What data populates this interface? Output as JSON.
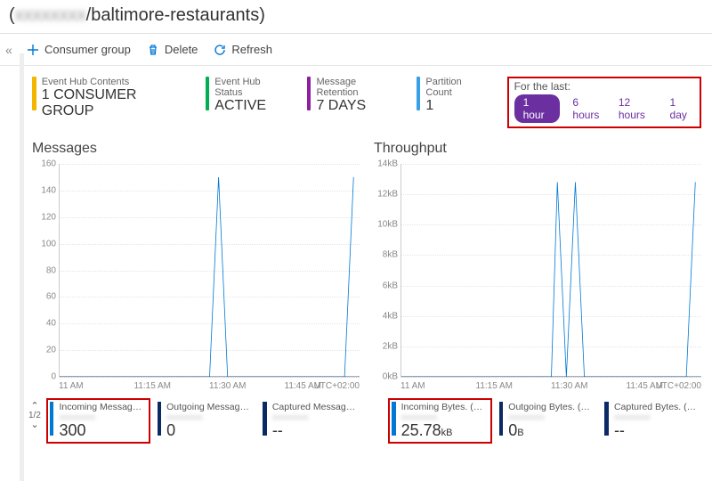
{
  "title_prefix_blurred": "xxxxxxxx",
  "title_suffix": "/baltimore-restaurants)",
  "toolbar": {
    "consumer_group": "Consumer group",
    "delete": "Delete",
    "refresh": "Refresh"
  },
  "stats": {
    "contents": {
      "label": "Event Hub Contents",
      "value": "1 CONSUMER GROUP",
      "color": "#f2b600"
    },
    "status": {
      "label": "Event Hub Status",
      "value": "ACTIVE",
      "color": "#00b050"
    },
    "retention": {
      "label": "Message Retention",
      "value": "7 DAYS",
      "color": "#8e1fa0"
    },
    "partition": {
      "label": "Partition Count",
      "value": "1",
      "color": "#39a0e8"
    }
  },
  "time_picker": {
    "header": "For the last:",
    "active": "1 hour",
    "options": [
      "1 hour",
      "6 hours",
      "12 hours",
      "1 day"
    ]
  },
  "charts": {
    "messages": {
      "title": "Messages",
      "timezone": "UTC+02:00"
    },
    "throughput": {
      "title": "Throughput",
      "timezone": "UTC+02:00"
    }
  },
  "legend": {
    "pager": "1/2",
    "messages": {
      "incoming": {
        "name": "Incoming Messages (Sum)",
        "value": "300",
        "unit": "",
        "color": "#0078d4"
      },
      "outgoing": {
        "name": "Outgoing Messages (Sum)",
        "value": "0",
        "unit": "",
        "color": "#0a2a66"
      },
      "captured": {
        "name": "Captured Messages. (…",
        "value": "--",
        "unit": "",
        "color": "#0a2a66"
      }
    },
    "throughput": {
      "incoming": {
        "name": "Incoming Bytes. (Sum)",
        "value": "25.78",
        "unit": "kB",
        "color": "#0078d4"
      },
      "outgoing": {
        "name": "Outgoing Bytes. (Sum)",
        "value": "0",
        "unit": "B",
        "color": "#0a2a66"
      },
      "captured": {
        "name": "Captured Bytes. (Sum)",
        "value": "--",
        "unit": "",
        "color": "#0a2a66"
      }
    }
  },
  "chart_data": [
    {
      "type": "line",
      "title": "Messages",
      "xlabel": "",
      "ylabel": "",
      "ylim": [
        0,
        160
      ],
      "yticks": [
        0,
        20,
        40,
        60,
        80,
        100,
        120,
        140,
        160
      ],
      "x_categories": [
        "11 AM",
        "11:15 AM",
        "11:30 AM",
        "11:45 AM"
      ],
      "series": [
        {
          "name": "Incoming Messages (Sum)",
          "color": "#0078d4",
          "points": [
            [
              0,
              0
            ],
            [
              0.5,
              0
            ],
            [
              0.53,
              150
            ],
            [
              0.56,
              0
            ],
            [
              0.95,
              0
            ],
            [
              0.98,
              150
            ]
          ]
        },
        {
          "name": "Outgoing Messages (Sum)",
          "color": "#0a2a66",
          "points": [
            [
              0,
              0
            ],
            [
              1,
              0
            ]
          ]
        },
        {
          "name": "Captured Messages",
          "color": "#0a2a66",
          "points": []
        }
      ]
    },
    {
      "type": "line",
      "title": "Throughput",
      "xlabel": "",
      "ylabel": "",
      "ylim": [
        0,
        14
      ],
      "yunit": "kB",
      "yticks": [
        0,
        2,
        4,
        6,
        8,
        10,
        12,
        14
      ],
      "x_categories": [
        "11 AM",
        "11:15 AM",
        "11:30 AM",
        "11:45 AM"
      ],
      "series": [
        {
          "name": "Incoming Bytes (Sum)",
          "color": "#0078d4",
          "points": [
            [
              0,
              0
            ],
            [
              0.5,
              0
            ],
            [
              0.52,
              12.8
            ],
            [
              0.55,
              0
            ],
            [
              0.58,
              12.8
            ],
            [
              0.61,
              0
            ],
            [
              0.95,
              0
            ],
            [
              0.98,
              12.8
            ]
          ]
        },
        {
          "name": "Outgoing Bytes (Sum)",
          "color": "#0a2a66",
          "points": [
            [
              0,
              0
            ],
            [
              1,
              0
            ]
          ]
        },
        {
          "name": "Captured Bytes",
          "color": "#0a2a66",
          "points": []
        }
      ]
    }
  ]
}
